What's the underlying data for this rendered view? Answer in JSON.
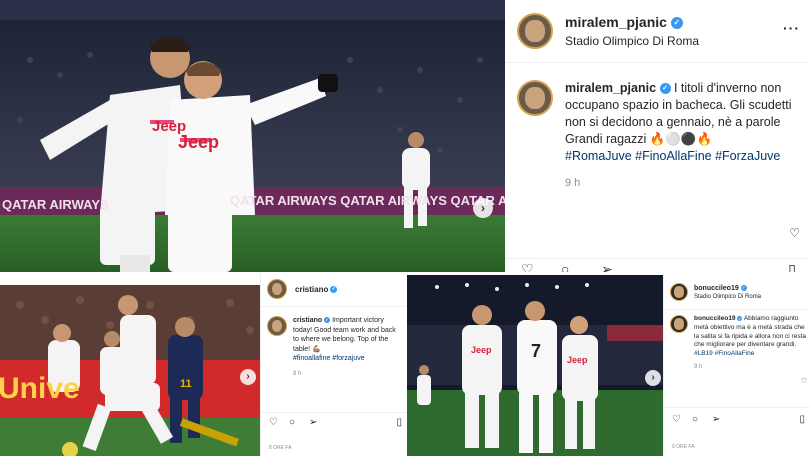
{
  "post_main": {
    "username": "miralem_pjanic",
    "location": "Stadio Olimpico Di Roma",
    "caption": "I titoli d'inverno non occupano spazio in bacheca. Gli scudetti non si decidono a gennaio, nè a parole",
    "caption_line2": "Grandi ragazzi 🔥⚪⚫🔥",
    "hashtags": "#RomaJuve #FinoAllaFine #ForzaJuve",
    "time": "9 h",
    "more_label": "···",
    "next_icon": "chevron-right-icon"
  },
  "photo_main": {
    "sponsor_text": "Jeep",
    "billboard_text": "QATAR AIRWAYS",
    "billboard_text_repeat": "QATAR AIRWAYS   QATAR AIRWAYS   QATAR AIRWAYS"
  },
  "post_cristiano": {
    "username": "cristiano",
    "caption": "Important victory today! Good team work and back to where we belong. Top of the table! 💪🏽",
    "hashtags": "#finoallafine #forzajuve",
    "time": "8 h"
  },
  "photo_cristiano": {
    "billboard_text": "Unive",
    "player_number": "11"
  },
  "post_bonucci": {
    "username": "bonucci",
    "username_suffix": "leo19",
    "location": "Stadio Olimpico Di Roma",
    "caption": "Abbiamo raggiunto metà obiettivo ma è a metà strada che la salita si fa ripida e allora non ci resta che migliorare per diventare grandi.",
    "hashtags": "#LB19 #FinoAllaFine",
    "time": "9 h",
    "footer_time": "9 ORE FA"
  },
  "post_small_footer": {
    "footer_time": "8 ORE FA"
  },
  "photo_bonucci": {
    "sponsor_text": "Jeep",
    "player_number": "7"
  },
  "colors": {
    "juve_white": "#f4f4f4",
    "pitch_green": "#2f6b2e",
    "billboard_purple": "#6b2a5a",
    "roma_navy": "#1c2a55",
    "hashtag_blue": "#00376b",
    "verified_blue": "#3897f0"
  }
}
